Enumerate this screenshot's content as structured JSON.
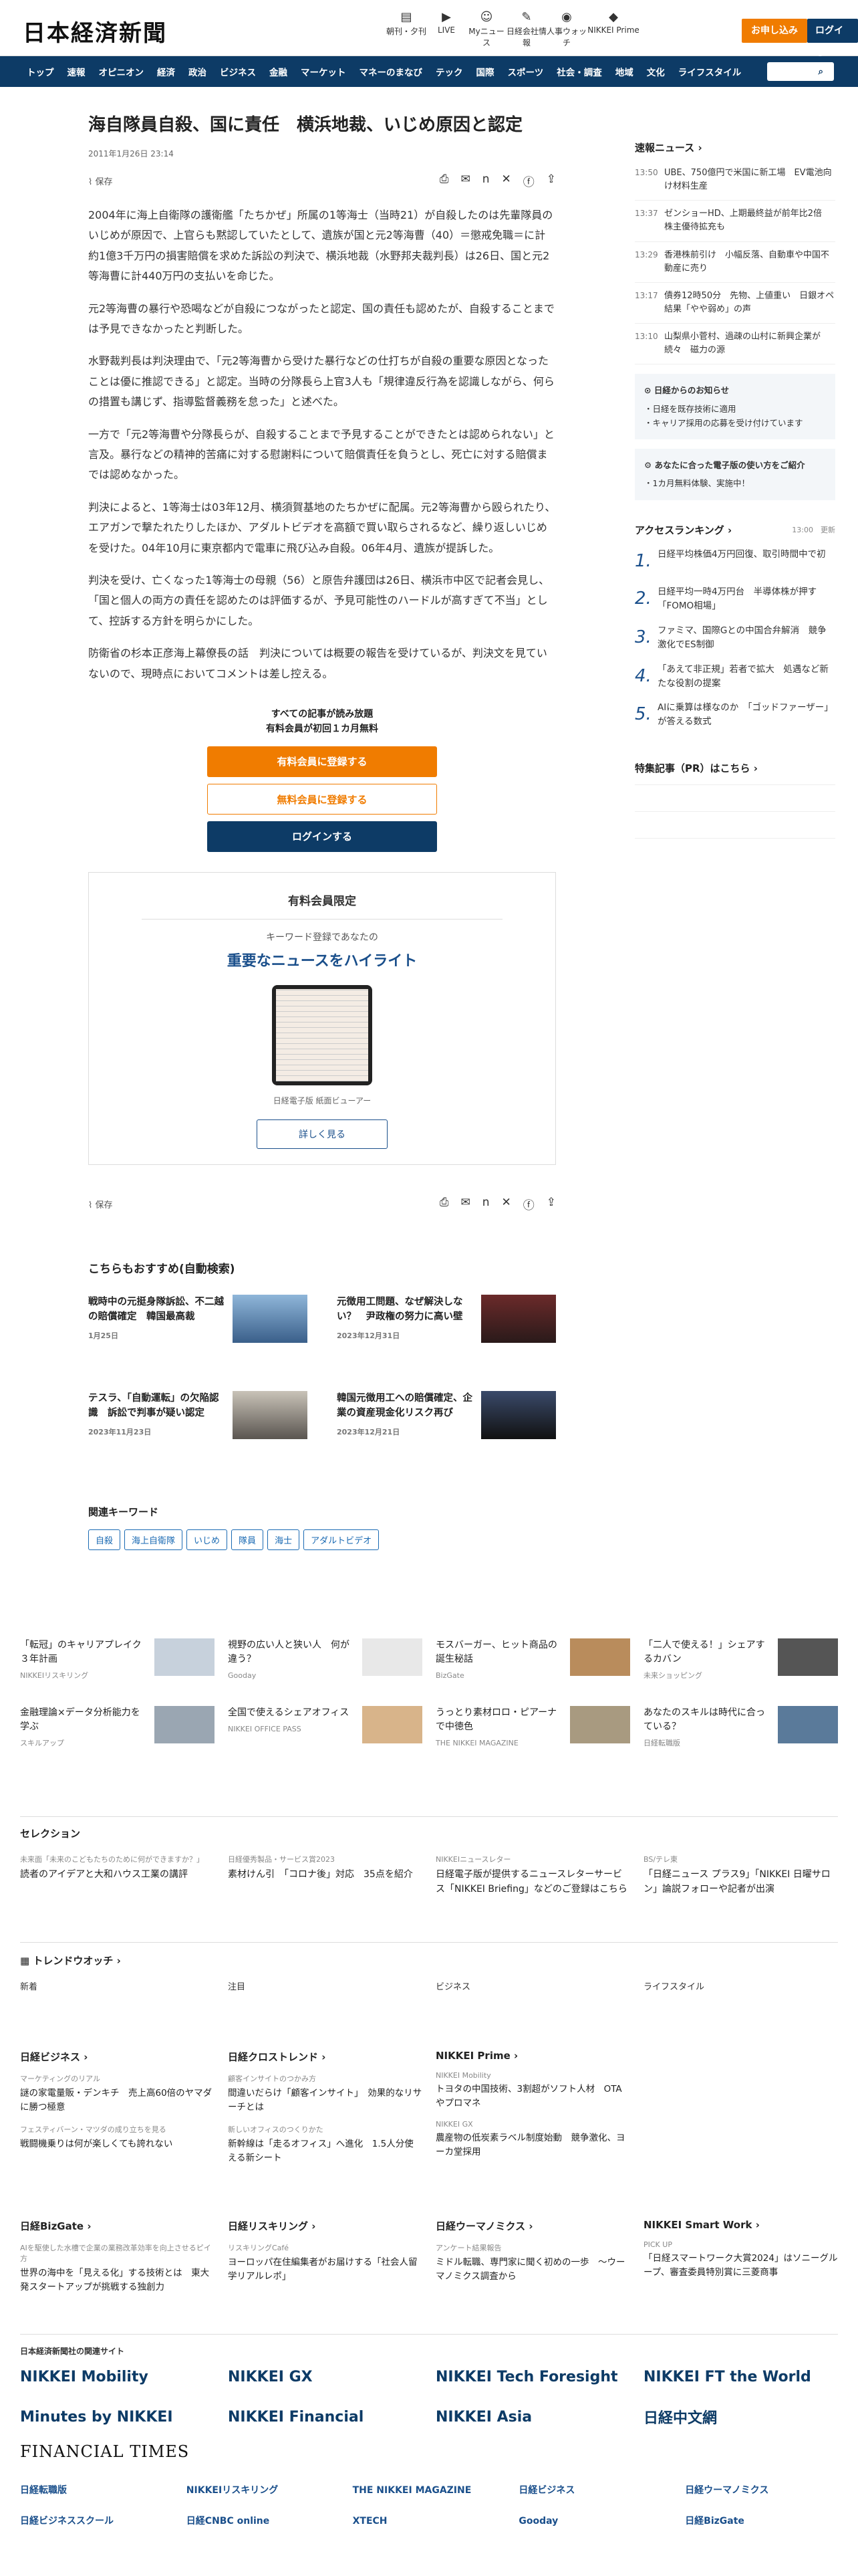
{
  "header": {
    "logo": "日本経済新聞",
    "icons": [
      {
        "icon": "paper-icon",
        "label": "朝刊・夕刊"
      },
      {
        "icon": "live-icon",
        "label": "LIVE"
      },
      {
        "icon": "user-icon",
        "label": "Myニュース"
      },
      {
        "icon": "pen-icon",
        "label": "日経会社情報"
      },
      {
        "icon": "person-icon",
        "label": "人事ウォッチ"
      },
      {
        "icon": "prime-icon",
        "label": "NIKKEI Prime"
      }
    ],
    "trial": "お申し込み",
    "login": "ログイン"
  },
  "nav": {
    "items": [
      "トップ",
      "速報",
      "オピニオン",
      "経済",
      "政治",
      "ビジネス",
      "金融",
      "マーケット",
      "マネーのまなび",
      "テック",
      "国際",
      "スポーツ",
      "社会・調査",
      "地域",
      "文化",
      "ライフスタイル"
    ],
    "search": "記事・検索"
  },
  "article": {
    "title": "海自隊員自殺、国に責任　横浜地裁、いじめ原因と認定",
    "date": "2011年1月26日 23:14",
    "save": "保存",
    "paragraphs": [
      "2004年に海上自衛隊の護衛艦「たちかぜ」所属の1等海士（当時21）が自殺したのは先輩隊員のいじめが原因で、上官らも黙認していたとして、遺族が国と元2等海曹（40）＝懲戒免職＝に計約1億3千万円の損害賠償を求めた訴訟の判決で、横浜地裁（水野邦夫裁判長）は26日、国と元2等海曹に計440万円の支払いを命じた。",
      "元2等海曹の暴行や恐喝などが自殺につながったと認定、国の責任も認めたが、自殺することまでは予見できなかったと判断した。",
      "水野裁判長は判決理由で、「元2等海曹から受けた暴行などの仕打ちが自殺の重要な原因となったことは優に推認できる」と認定。当時の分隊長ら上官3人も「規律違反行為を認識しながら、何らの措置も講じず、指導監督義務を怠った」と述べた。",
      "一方で「元2等海曹や分隊長らが、自殺することまで予見することができたとは認められない」と言及。暴行などの精神的苦痛に対する慰謝料について賠償責任を負うとし、死亡に対する賠償までは認めなかった。",
      "判決によると、1等海士は03年12月、横須賀基地のたちかぜに配属。元2等海曹から殴られたり、エアガンで撃たれたりしたほか、アダルトビデオを高額で買い取らされるなど、繰り返しいじめを受けた。04年10月に東京都内で電車に飛び込み自殺。06年4月、遺族が提訴した。",
      "判決を受け、亡くなった1等海士の母親（56）と原告弁護団は26日、横浜市中区で記者会見し、「国と個人の両方の責任を認めたのは評価するが、予見可能性のハードルが高すぎて不当」として、控訴する方針を明らかにした。",
      "防衛省の杉本正彦海上幕僚長の話　判決については概要の報告を受けているが、判決文を見ていないので、現時点においてコメントは差し控える。"
    ]
  },
  "paywall": {
    "line1": "すべての記事が読み放題",
    "line2": "有料会員が初回１カ月無料",
    "paid": "有料会員に登録する",
    "free": "無料会員に登録する",
    "login": "ログインする"
  },
  "promo": {
    "title": "有料会員限定",
    "sub": "キーワード登録であなたの",
    "highlight": "重要なニュースをハイライト",
    "caption": "日経電子版 紙面ビューアー",
    "button": "詳しく見る"
  },
  "recommend": {
    "title": "こちらもおすすめ(自動検索)",
    "items": [
      {
        "title": "戦時中の元挺身隊訴訟、不二越の賠償確定　韓国最高裁",
        "date": "1月25日"
      },
      {
        "title": "元徴用工問題、なぜ解決しない？　尹政権の努力に高い壁",
        "date": "2023年12月31日"
      },
      {
        "title": "テスラ、「自動運転」の欠陥認識　訴訟で判事が疑い認定",
        "date": "2023年11月23日"
      },
      {
        "title": "韓国元徴用工への賠償確定、企業の資産現金化リスク再び",
        "date": "2023年12月21日"
      }
    ]
  },
  "keywords": {
    "title": "関連キーワード",
    "items": [
      "自殺",
      "海上自衛隊",
      "いじめ",
      "隊員",
      "海士",
      "アダルトビデオ"
    ]
  },
  "sidebar": {
    "flash_title": "速報ニュース",
    "flash": [
      {
        "time": "13:50",
        "text": "UBE、750億円で米国に新工場　EV電池向け材料生産"
      },
      {
        "time": "13:37",
        "text": "ゼンショーHD、上期最終益が前年比2倍　株主優待拡充も"
      },
      {
        "time": "13:29",
        "text": "香港株前引け　小幅反落、自動車や中国不動産に売り"
      },
      {
        "time": "13:17",
        "text": "債券12時50分　先物、上値重い　日銀オペ結果「やや弱め」の声"
      },
      {
        "time": "13:10",
        "text": "山梨県小菅村、過疎の山村に新興企業が続々　磁力の源"
      }
    ],
    "info_title": "日経からのお知らせ",
    "info": [
      "日経を既存技術に適用",
      "キャリア採用の応募を受け付けています"
    ],
    "account_title": "あなたに合った電子版の使い方をご紹介",
    "account_sub": "1カ月無料体験、実施中！",
    "rank_title": "アクセスランキング",
    "rank_time": "13:00　更新",
    "ranks": [
      "日経平均株価4万円回復、取引時間中で初",
      "日経平均一時4万円台　半導体株が押す「FOMO相場」",
      "ファミマ、国際Gとの中国合弁解消　競争激化でES制御",
      "「あえて非正規」若者で拡大　処遇など新たな役割の提案",
      "AIに乗算は様なのか　「ゴッドファーザー」が答える数式"
    ],
    "pr_title": "特集記事（PR）はこちら"
  },
  "ads": [
    {
      "text": "「転冠」のキャリアプレイク３年計画",
      "src": "NIKKEIリスキリング"
    },
    {
      "text": "視野の広い人と狭い人　何が違う？",
      "src": "Gooday"
    },
    {
      "text": "モスバーガー、ヒット商品の誕生秘話",
      "src": "BizGate"
    },
    {
      "text": "「二人で使える！」シェアするカバン",
      "src": "未来ショッピング"
    },
    {
      "text": "金融理論×データ分析能力を学ぶ",
      "src": "スキルアップ"
    },
    {
      "text": "全国で使えるシェアオフィス",
      "src": "NIKKEI OFFICE PASS"
    },
    {
      "text": "うっとり素材ロロ・ピアーナで中徳色",
      "src": "THE NIKKEI MAGAZINE"
    },
    {
      "text": "あなたのスキルは時代に合っている？",
      "src": "日経転職版"
    }
  ],
  "selection": {
    "title": "セレクション",
    "items": [
      {
        "k": "未来面「未来のこどもたちのために何ができますか？」",
        "v": "読者のアイデアと大和ハウス工業の講評"
      },
      {
        "k": "日経優秀製品・サービス賞2023",
        "v": "素材けん引　「コロナ後」対応　35点を紹介"
      },
      {
        "k": "NIKKEIニュースレター",
        "v": "日経電子版が提供するニュースレターサービス「NIKKEI Briefing」などのご登録はこちら"
      },
      {
        "k": "BS/テレ東",
        "v": "「日経ニュース プラス9」「NIKKEI 日曜サロン」論説フォローや記者が出演"
      }
    ]
  },
  "trend": {
    "title": "トレンドウオッチ",
    "cols": [
      "新着",
      "注目",
      "ビジネス",
      "ライフスタイル"
    ]
  },
  "brands": [
    {
      "bt": "日経ビジネス",
      "s1": "マーケティングのリアル",
      "t1": "謎の家電量販・デンキチ　売上高60倍のヤマダに勝つ極意",
      "s2": "フェスティバーン・マツダの成り立ちを見る",
      "t2": "戦闘機乗りは何が楽しくても誇れない"
    },
    {
      "bt": "日経クロストレンド",
      "s1": "顧客インサイトのつかみ方",
      "t1": "間違いだらけ「顧客インサイト」　効果的なリサーチとは",
      "s2": "新しいオフィスのつくりかた",
      "t2": "新幹線は「走るオフィス」へ進化　1.5人分使える新シート"
    },
    {
      "bt": "NIKKEI Prime",
      "s1": "NIKKEI Mobility",
      "t1": "トヨタの中国技術、3割超がソフト人材　OTAやプロマネ",
      "s2": "NIKKEI GX",
      "t2": "農産物の低炭素ラベル制度始動　競争激化、ヨーカ堂採用"
    },
    {
      "bt": "",
      "s1": "",
      "t1": "",
      "s2": "",
      "t2": ""
    }
  ],
  "brands2": [
    {
      "bt": "日経BizGate",
      "s1": "AIを駆使した水槽で企業の業務改革効率を向上させるピイ方",
      "t1": "世界の海中を「見える化」する技術とは　東大発スタートアップが挑戦する独創力"
    },
    {
      "bt": "日経リスキリング",
      "s1": "リスキリングCafé",
      "t1": "ヨーロッパ在住編集者がお届けする「社会人留学リアルレポ」"
    },
    {
      "bt": "日経ウーマノミクス",
      "s1": "アンケート結果報告",
      "t1": "ミドル転職、専門家に聞く初めの一歩　～ウーマノミクス調査から"
    },
    {
      "bt": "NIKKEI Smart Work",
      "s1": "PICK UP",
      "t1": "「日経スマートワーク大賞2024」はソニーグループ、審査委員特別賞に三菱商事"
    }
  ],
  "group": {
    "title": "日本経済新聞社の関連サイト",
    "logos": [
      "NIKKEI Mobility",
      "NIKKEI GX",
      "NIKKEI Tech Foresight",
      "NIKKEI FT the World",
      "Minutes by NIKKEI",
      "NIKKEI Financial",
      "NIKKEI Asia",
      "日経中文網"
    ],
    "ft": "FINANCIAL TIMES",
    "small": [
      "日経転職版",
      "NIKKEIリスキリング",
      "THE NIKKEI MAGAZINE",
      "日経ビジネス",
      "日経ウーマノミクス",
      "日経ビジネススクール",
      "日経CNBC online",
      "XTECH",
      "Gooday",
      "日経BizGate"
    ]
  },
  "colors": {
    "nav": "#0d3b66",
    "accent": "#f07c00",
    "navy": "#0d3b66"
  }
}
